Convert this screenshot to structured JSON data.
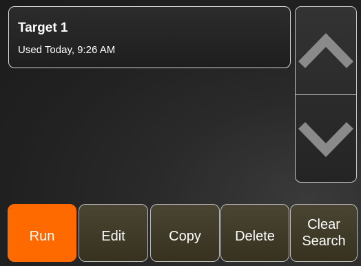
{
  "list": {
    "items": [
      {
        "title": "Target 1",
        "subtitle": "Used Today, 9:26 AM"
      }
    ]
  },
  "scroll": {
    "up_icon": "chevron-up-icon",
    "down_icon": "chevron-down-icon"
  },
  "toolbar": {
    "run_label": "Run",
    "edit_label": "Edit",
    "copy_label": "Copy",
    "delete_label": "Delete",
    "clear_line1": "Clear",
    "clear_line2": "Search"
  },
  "colors": {
    "accent": "#ff6a00",
    "button_bg": "#3d3827",
    "panel_bg": "#262626"
  }
}
